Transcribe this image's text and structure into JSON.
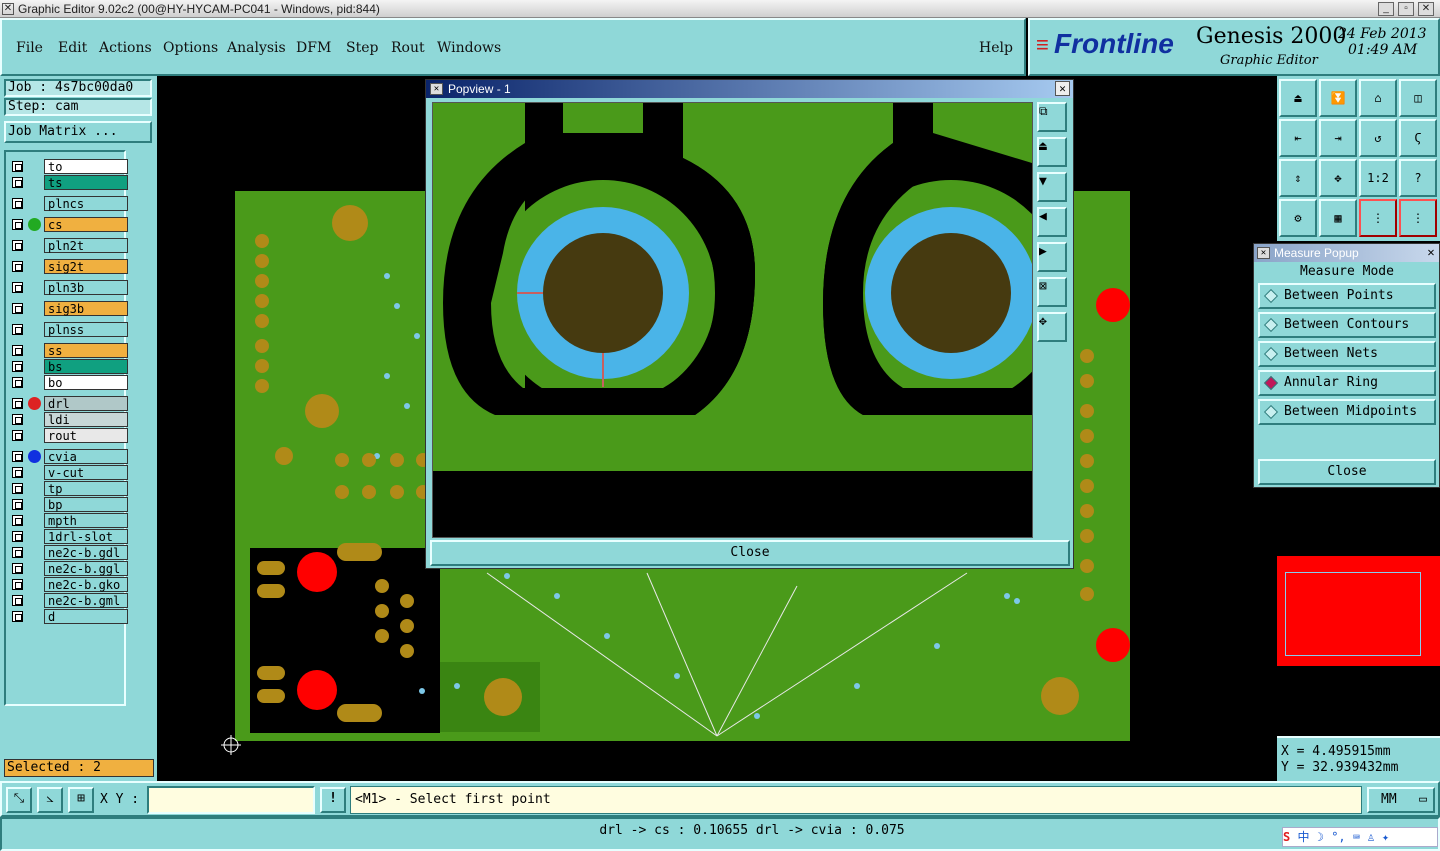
{
  "window": {
    "title": "Graphic Editor 9.02c2 (00@HY-HYCAM-PC041 - Windows, pid:844)"
  },
  "menu": [
    "File",
    "Edit",
    "Actions",
    "Options",
    "Analysis",
    "DFM",
    "Step",
    "Rout",
    "Windows",
    "Help"
  ],
  "brand": {
    "logo": "Frontline",
    "product": "Genesis 2000",
    "subtitle": "Graphic Editor",
    "date": "24 Feb 2013",
    "time": "01:49 AM"
  },
  "job": {
    "job_label": "Job : 4s7bc00da0",
    "step_label": "Step: cam",
    "matrix_button": "Job Matrix ..."
  },
  "layers": [
    {
      "name": "to",
      "color": "#ffffff",
      "mark": "✎"
    },
    {
      "name": "ts",
      "color": "#10a080",
      "mark": ""
    },
    {
      "name": "plncs",
      "color": "#8fd8d8",
      "mark": ""
    },
    {
      "name": "cs",
      "color": "#f0b040",
      "mark": "✎",
      "dot": "#22aa22"
    },
    {
      "name": "pln2t",
      "color": "#8fd8d8",
      "mark": ""
    },
    {
      "name": "sig2t",
      "color": "#f0b040",
      "mark": "✎"
    },
    {
      "name": "pln3b",
      "color": "#8fd8d8",
      "mark": ""
    },
    {
      "name": "sig3b",
      "color": "#f0b040",
      "mark": "✎"
    },
    {
      "name": "plnss",
      "color": "#8fd8d8",
      "mark": ""
    },
    {
      "name": "ss",
      "color": "#f0b040",
      "mark": "✎"
    },
    {
      "name": "bs",
      "color": "#10a080",
      "mark": ""
    },
    {
      "name": "bo",
      "color": "#ffffff",
      "mark": "✎"
    },
    {
      "name": "drl",
      "color": "#b0c8c8",
      "mark": "⊞",
      "dot": "#dd2222"
    },
    {
      "name": "ldi",
      "color": "#c8d8d8",
      "mark": ""
    },
    {
      "name": "rout",
      "color": "#e8e8e8",
      "mark": ""
    },
    {
      "name": "cvia",
      "color": "#8fd8d8",
      "mark": "",
      "dot": "#1030e0"
    },
    {
      "name": "v-cut",
      "color": "#8fd8d8",
      "mark": ""
    },
    {
      "name": "tp",
      "color": "#8fd8d8",
      "mark": ""
    },
    {
      "name": "bp",
      "color": "#8fd8d8",
      "mark": ""
    },
    {
      "name": "mpth",
      "color": "#8fd8d8",
      "mark": ""
    },
    {
      "name": "1drl-slot",
      "color": "#8fd8d8",
      "mark": ""
    },
    {
      "name": "ne2c-b.gdl",
      "color": "#8fd8d8",
      "mark": "✎"
    },
    {
      "name": "ne2c-b.ggl",
      "color": "#8fd8d8",
      "mark": ""
    },
    {
      "name": "ne2c-b.gko",
      "color": "#8fd8d8",
      "mark": ""
    },
    {
      "name": "ne2c-b.gml",
      "color": "#8fd8d8",
      "mark": ""
    },
    {
      "name": "d",
      "color": "#8fd8d8",
      "mark": ""
    }
  ],
  "selected": "Selected : 2",
  "popview": {
    "title": "Popview - 1",
    "close": "Close"
  },
  "measure": {
    "title": "Measure Popup",
    "mode_label": "Measure Mode",
    "options": [
      "Between Points",
      "Between Contours",
      "Between Nets",
      "Annular Ring",
      "Between Midpoints"
    ],
    "selected": "Annular Ring",
    "close": "Close"
  },
  "toolbox": [
    "",
    "",
    "",
    "",
    "",
    "",
    "",
    "",
    "",
    "",
    "1:2",
    "?",
    "",
    "",
    "",
    ""
  ],
  "coords": {
    "x": "X = 4.495915mm",
    "y": "Y = 32.939432mm"
  },
  "bottom": {
    "xy_label": "X Y :",
    "xy_value": "",
    "prompt": "<M1> - Select first point",
    "units": "MM"
  },
  "status": {
    "text": "drl -> cs : 0.10655   drl -> cvia : 0.075"
  },
  "colors": {
    "panel": "#8fd8d8",
    "board": "#4a9a1a",
    "copper": "#b08a18",
    "pad_red": "#ff0000",
    "annular": "#4ab4e8"
  }
}
